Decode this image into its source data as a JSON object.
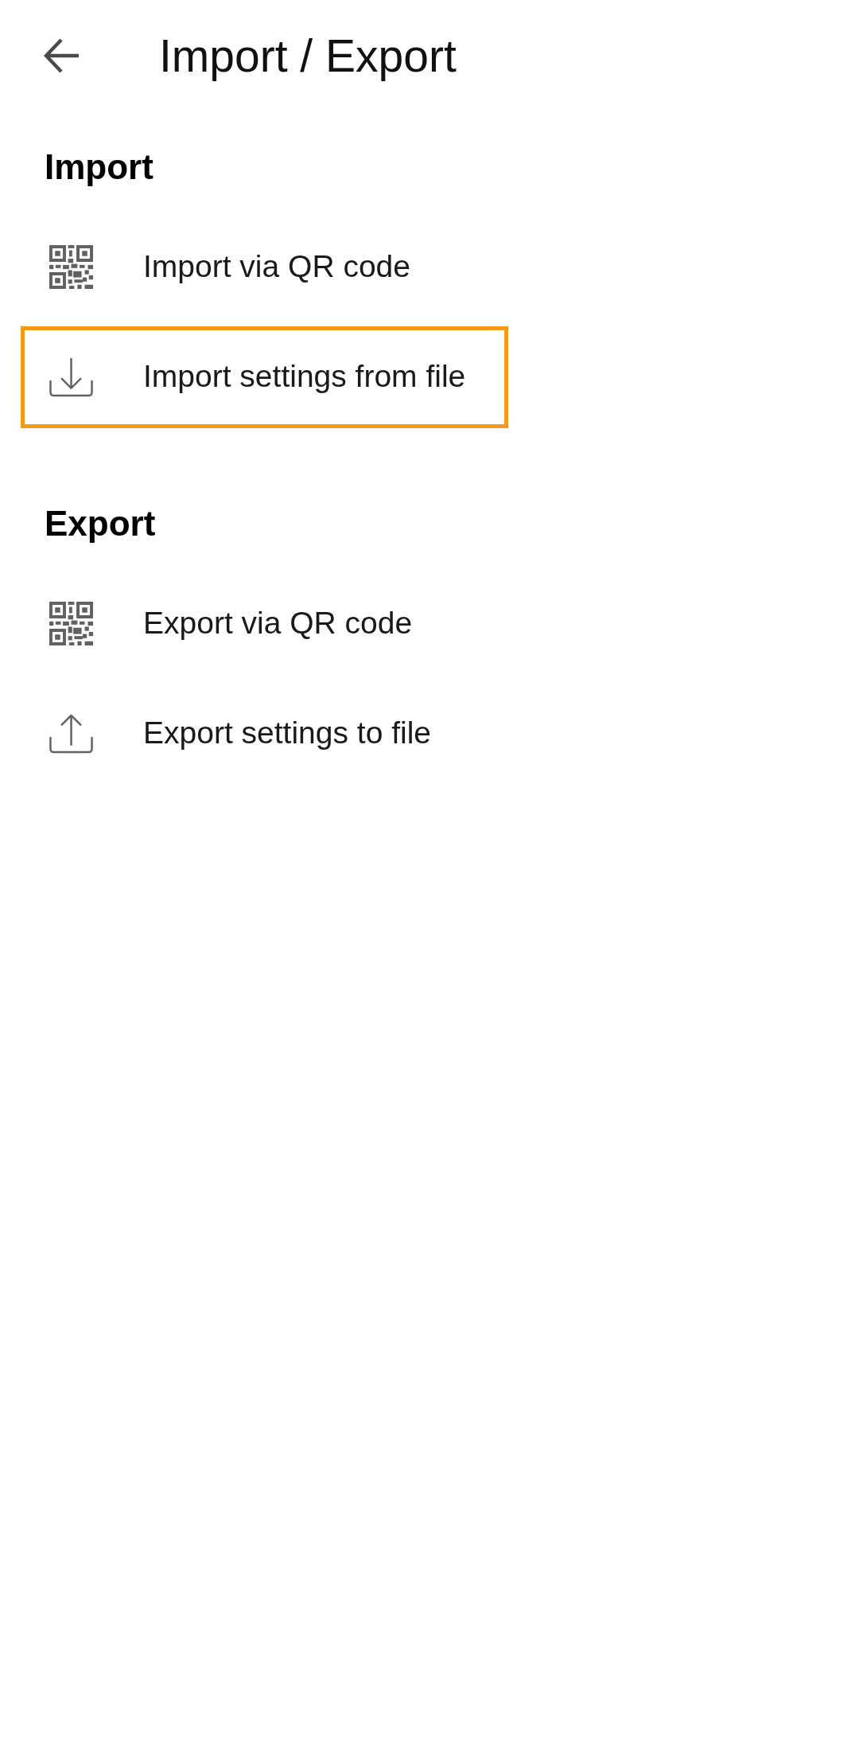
{
  "top_bar": {
    "title": "Import / Export"
  },
  "sections": [
    {
      "title": "Import",
      "items": [
        {
          "kind": "qr_code",
          "label": "Import via QR code",
          "selected": false
        },
        {
          "kind": "import_file",
          "label": "Import settings from file",
          "selected": true
        }
      ]
    },
    {
      "title": "Export",
      "items": [
        {
          "kind": "qr_code",
          "label": "Export via QR code",
          "selected": false
        },
        {
          "kind": "export_file",
          "label": "Export settings to file",
          "selected": false
        }
      ]
    }
  ]
}
